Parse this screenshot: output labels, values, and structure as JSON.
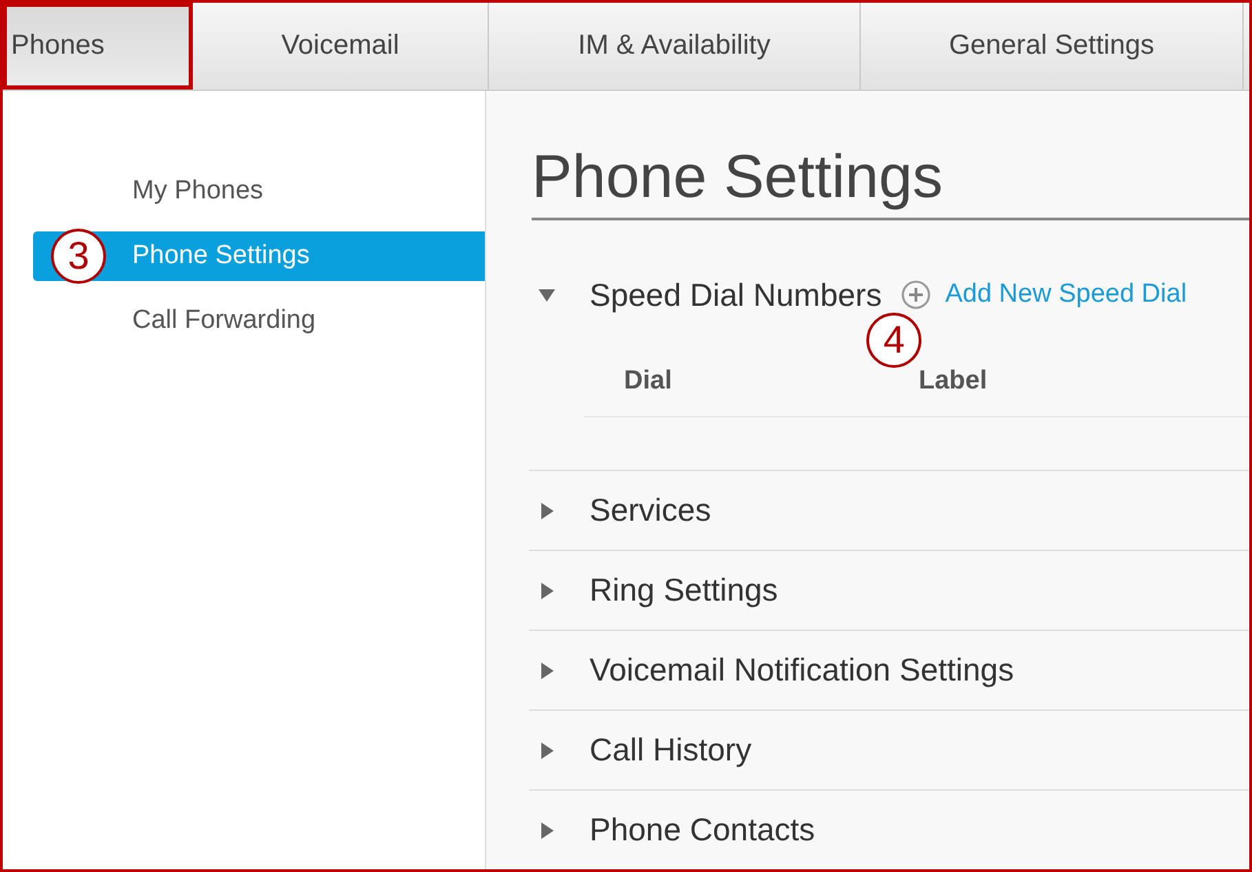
{
  "tabs": [
    {
      "label": "Phones",
      "selected": true,
      "highlighted": true
    },
    {
      "label": "Voicemail",
      "selected": false,
      "highlighted": false
    },
    {
      "label": "IM & Availability",
      "selected": false,
      "highlighted": false
    },
    {
      "label": "General Settings",
      "selected": false,
      "highlighted": false
    }
  ],
  "sidebar": {
    "items": [
      {
        "label": "My Phones",
        "selected": false
      },
      {
        "label": "Phone Settings",
        "selected": true,
        "callout": "3"
      },
      {
        "label": "Call Forwarding",
        "selected": false
      }
    ]
  },
  "page_title": "Phone Settings",
  "sections": [
    {
      "title": "Speed Dial Numbers",
      "expanded": true,
      "action": "Add New Speed Dial",
      "callout": "4",
      "columns": [
        "Dial",
        "Label"
      ]
    },
    {
      "title": "Services",
      "expanded": false
    },
    {
      "title": "Ring Settings",
      "expanded": false
    },
    {
      "title": "Voicemail Notification Settings",
      "expanded": false
    },
    {
      "title": "Call History",
      "expanded": false
    },
    {
      "title": "Phone Contacts",
      "expanded": false
    }
  ]
}
